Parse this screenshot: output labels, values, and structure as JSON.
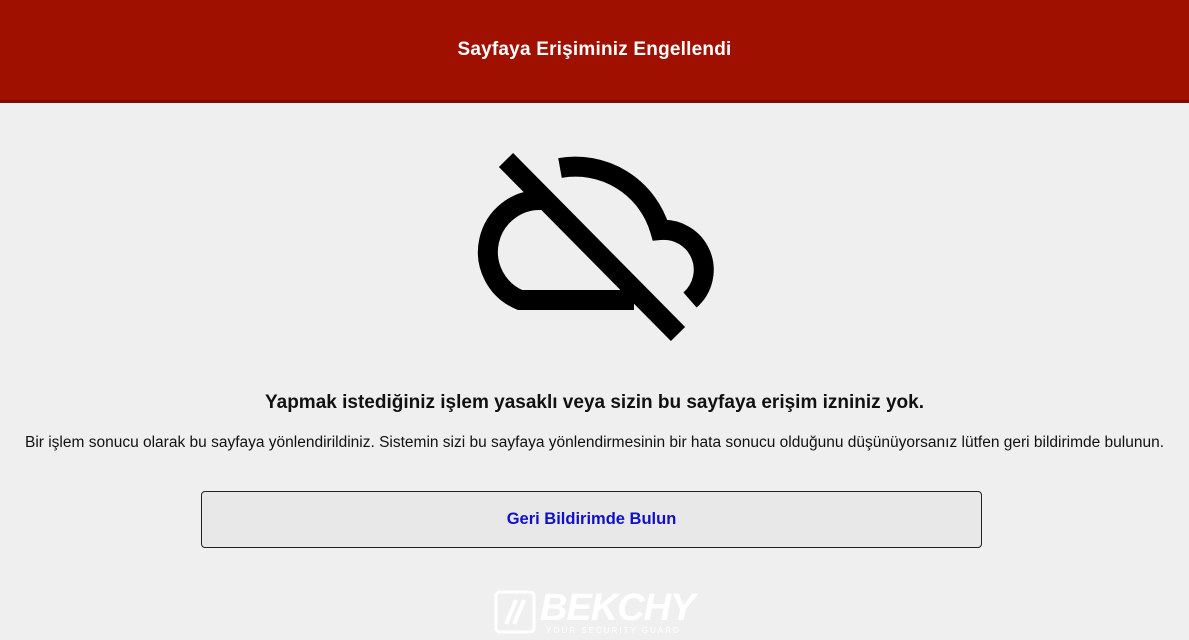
{
  "header": {
    "title": "Sayfaya Erişiminiz Engellendi"
  },
  "main": {
    "icon": "cloud-off-icon",
    "heading": "Yapmak istediğiniz işlem yasaklı veya sizin bu sayfaya erişim izniniz yok.",
    "description": "Bir işlem sonucu olarak bu sayfaya yönlendirildiniz. Sistemin sizi bu sayfaya yönlendirmesinin bir hata sonucu olduğunu düşünüyorsanız lütfen geri bildirimde bulunun.",
    "feedback_button": "Geri Bildirimde Bulun"
  },
  "footer": {
    "logo_text": "BEKCHY",
    "logo_tagline": "YOUR SECURITY GUARD"
  },
  "colors": {
    "header_bg": "#a01000",
    "page_bg": "#efefef",
    "link_blue": "#1010c8"
  }
}
